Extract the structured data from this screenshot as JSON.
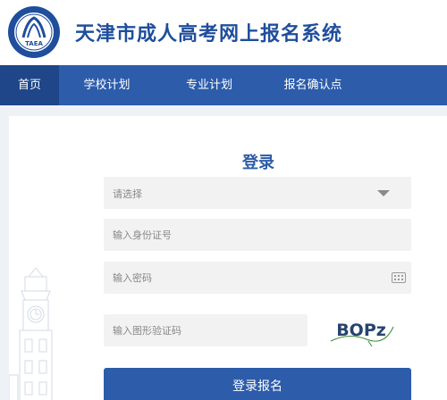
{
  "header": {
    "site_title": "天津市成人高考网上报名系统",
    "logo_text": "TAEA",
    "logo_ring_text": "天津市教育招生考试院"
  },
  "nav": {
    "items": [
      {
        "label": "首页",
        "active": true
      },
      {
        "label": "学校计划",
        "active": false
      },
      {
        "label": "专业计划",
        "active": false
      },
      {
        "label": "报名确认点",
        "active": false
      }
    ]
  },
  "login": {
    "title": "登录",
    "select_placeholder": "请选择",
    "id_placeholder": "输入身份证号",
    "password_placeholder": "输入密码",
    "captcha_placeholder": "输入图形验证码",
    "captcha_text": "BOPz",
    "submit_label": "登录报名"
  },
  "colors": {
    "brand": "#2c5caa",
    "nav_active": "#1e4688",
    "title": "#1f4e9c",
    "field_bg": "#f2f2f2"
  }
}
